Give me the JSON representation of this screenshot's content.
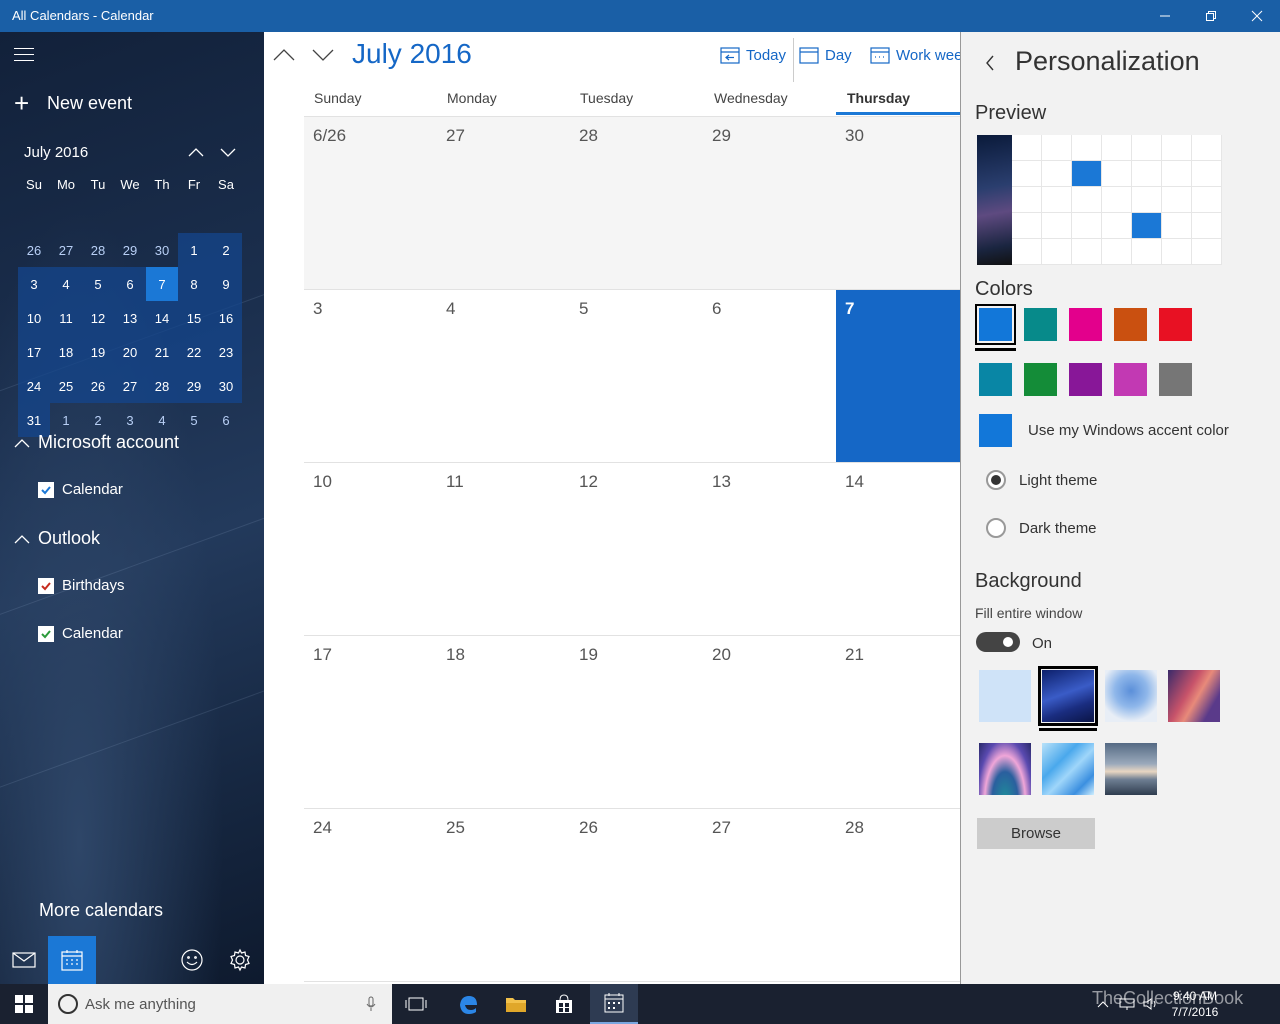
{
  "window": {
    "title": "All Calendars - Calendar",
    "controls": [
      "minimize-icon",
      "restore-icon",
      "close-icon"
    ]
  },
  "sidebar": {
    "new_event_label": "New event",
    "mini_calendar": {
      "month_label": "July 2016",
      "weekdays": [
        "Su",
        "Mo",
        "Tu",
        "We",
        "Th",
        "Fr",
        "Sa"
      ],
      "weeks": [
        [
          "26",
          "27",
          "28",
          "29",
          "30",
          "1",
          "2"
        ],
        [
          "3",
          "4",
          "5",
          "6",
          "7",
          "8",
          "9"
        ],
        [
          "10",
          "11",
          "12",
          "13",
          "14",
          "15",
          "16"
        ],
        [
          "17",
          "18",
          "19",
          "20",
          "21",
          "22",
          "23"
        ],
        [
          "24",
          "25",
          "26",
          "27",
          "28",
          "29",
          "30"
        ],
        [
          "31",
          "1",
          "2",
          "3",
          "4",
          "5",
          "6"
        ]
      ],
      "selected_day": "7"
    },
    "accounts": [
      {
        "name": "Microsoft account",
        "calendars": [
          {
            "label": "Calendar",
            "checked": true,
            "color": "#1b78d6"
          }
        ]
      },
      {
        "name": "Outlook",
        "calendars": [
          {
            "label": "Birthdays",
            "checked": true,
            "color": "#c62b1e"
          },
          {
            "label": "Calendar",
            "checked": true,
            "color": "#2b9a3a"
          }
        ]
      }
    ],
    "more_calendars_label": "More calendars",
    "bottom_icons": [
      "mail-icon",
      "calendar-icon",
      "feedback-smiley-icon",
      "settings-gear-icon"
    ]
  },
  "main": {
    "month_title": "July 2016",
    "toolbar": {
      "today_label": "Today",
      "day_label": "Day",
      "workweek_label": "Work week"
    },
    "weekday_headers": [
      "Sunday",
      "Monday",
      "Tuesday",
      "Wednesday",
      "Thursday"
    ],
    "active_weekday": "Thursday",
    "weeks": [
      [
        "6/26",
        "27",
        "28",
        "29",
        "30"
      ],
      [
        "3",
        "4",
        "5",
        "6",
        "7"
      ],
      [
        "10",
        "11",
        "12",
        "13",
        "14"
      ],
      [
        "17",
        "18",
        "19",
        "20",
        "21"
      ],
      [
        "24",
        "25",
        "26",
        "27",
        "28"
      ]
    ],
    "today": "7"
  },
  "personalization": {
    "title": "Personalization",
    "preview_heading": "Preview",
    "colors_heading": "Colors",
    "color_swatches": [
      "#1277d9",
      "#078a8a",
      "#e3008c",
      "#ca5010",
      "#e81123",
      "#0986a5",
      "#148c38",
      "#881798",
      "#c239b3",
      "#767676"
    ],
    "selected_color": "#1277d9",
    "accent_option_label": "Use my Windows accent color",
    "accent_color": "#1277d9",
    "themes": [
      {
        "label": "Light theme",
        "selected": true
      },
      {
        "label": "Dark theme",
        "selected": false
      }
    ],
    "background_heading": "Background",
    "fill_window_label": "Fill entire window",
    "fill_window_state": "On",
    "background_thumbs": [
      "pale-blue",
      "starry-night",
      "blue-tree",
      "canyon",
      "colorful-hills",
      "blue-polygons",
      "lake-sunset"
    ],
    "selected_background": "starry-night",
    "browse_label": "Browse"
  },
  "taskbar": {
    "search_placeholder": "Ask me anything",
    "apps": [
      "task-view-icon",
      "edge-icon",
      "file-explorer-icon",
      "store-icon",
      "calendar-app-icon"
    ],
    "time": "9:40 AM",
    "date": "7/7/2016",
    "watermark": "TheCollectionBook"
  }
}
